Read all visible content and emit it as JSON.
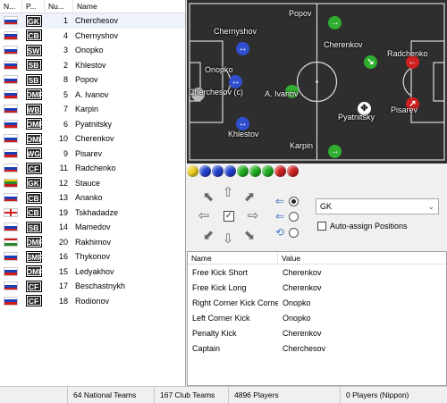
{
  "list": {
    "headers": {
      "nationality": "N...",
      "position": "P...",
      "number": "Nu...",
      "name": "Name"
    },
    "players": [
      {
        "flag": "russia",
        "pos": "GK",
        "num": "1",
        "name": "Cherchesov"
      },
      {
        "flag": "russia",
        "pos": "CB",
        "num": "4",
        "name": "Chernyshov"
      },
      {
        "flag": "russia",
        "pos": "SW",
        "num": "3",
        "name": "Onopko"
      },
      {
        "flag": "russia",
        "pos": "SB",
        "num": "2",
        "name": "Khlestov"
      },
      {
        "flag": "russia",
        "pos": "SB",
        "num": "8",
        "name": "Popov"
      },
      {
        "flag": "russia",
        "pos": "DMF",
        "num": "5",
        "name": "A. Ivanov"
      },
      {
        "flag": "russia",
        "pos": "WB",
        "num": "7",
        "name": "Karpin"
      },
      {
        "flag": "russia",
        "pos": "OMF",
        "num": "6",
        "name": "Pyatnitsky"
      },
      {
        "flag": "russia",
        "pos": "OMF",
        "num": "10",
        "name": "Cherenkov"
      },
      {
        "flag": "russia",
        "pos": "WG",
        "num": "9",
        "name": "Pisarev"
      },
      {
        "flag": "russia",
        "pos": "CF",
        "num": "11",
        "name": "Radchenko"
      },
      {
        "flag": "lithuania",
        "pos": "GK",
        "num": "12",
        "name": "Stauce"
      },
      {
        "flag": "russia",
        "pos": "CB",
        "num": "13",
        "name": "Ananko"
      },
      {
        "flag": "georgia",
        "pos": "CB",
        "num": "19",
        "name": "Tskhadadze"
      },
      {
        "flag": "russia",
        "pos": "SB",
        "num": "14",
        "name": "Mamedov"
      },
      {
        "flag": "tajikistan",
        "pos": "DMF",
        "num": "20",
        "name": "Rakhimov"
      },
      {
        "flag": "russia",
        "pos": "SMF",
        "num": "16",
        "name": "Thykonov"
      },
      {
        "flag": "russia",
        "pos": "OMF",
        "num": "15",
        "name": "Ledyakhov"
      },
      {
        "flag": "russia",
        "pos": "CF",
        "num": "17",
        "name": "Beschastnykh"
      },
      {
        "flag": "russia",
        "pos": "CF",
        "num": "18",
        "name": "Rodionov"
      }
    ]
  },
  "pitch": {
    "players": [
      {
        "name": "Popov",
        "color": "#2fae2f",
        "arrow": "→"
      },
      {
        "name": "Chernyshov",
        "color": "#3050d0",
        "arrow": "↔"
      },
      {
        "name": "Cherenkov",
        "color": "#2fae2f",
        "arrow": "↘"
      },
      {
        "name": "Radchenko",
        "color": "#d02020",
        "arrow": "←"
      },
      {
        "name": "Onopko",
        "color": "#3050d0",
        "arrow": "↔"
      },
      {
        "name": "Cherchesov (c)",
        "color": "#bbbbbb",
        "arrow": ""
      },
      {
        "name": "A. Ivanov",
        "color": "#2fae2f",
        "arrow": "←"
      },
      {
        "name": "Pisarev",
        "color": "#d02020",
        "arrow": "↗"
      },
      {
        "name": "Pyatnitsky",
        "color": "#ffffff",
        "arrow": "✥"
      },
      {
        "name": "Khlestov",
        "color": "#3050d0",
        "arrow": "↔"
      },
      {
        "name": "Karpin",
        "color": "#2fae2f",
        "arrow": "→"
      }
    ]
  },
  "balls": [
    "#f0d020",
    "#2040d0",
    "#2040d0",
    "#2040d0",
    "#20b020",
    "#20b020",
    "#20b020",
    "#d02020",
    "#d02020"
  ],
  "controls": {
    "selected_position": "GK",
    "auto_assign_label": "Auto-assign Positions"
  },
  "settings": {
    "headers": {
      "name": "Name",
      "value": "Value"
    },
    "rows": [
      {
        "name": "Free Kick Short",
        "value": "Cherenkov"
      },
      {
        "name": "Free Kick Long",
        "value": "Cherenkov"
      },
      {
        "name": "Right Corner Kick Corner",
        "value": "Onopko"
      },
      {
        "name": "Left Corner Kick",
        "value": "Onopko"
      },
      {
        "name": "Penalty Kick",
        "value": "Cherenkov"
      },
      {
        "name": "Captain",
        "value": "Cherchesov"
      }
    ]
  },
  "status": {
    "national_teams": "64 National Teams",
    "club_teams": "167 Club Teams",
    "players": "4896 Players",
    "nippon": "0 Players (Nippon)"
  }
}
